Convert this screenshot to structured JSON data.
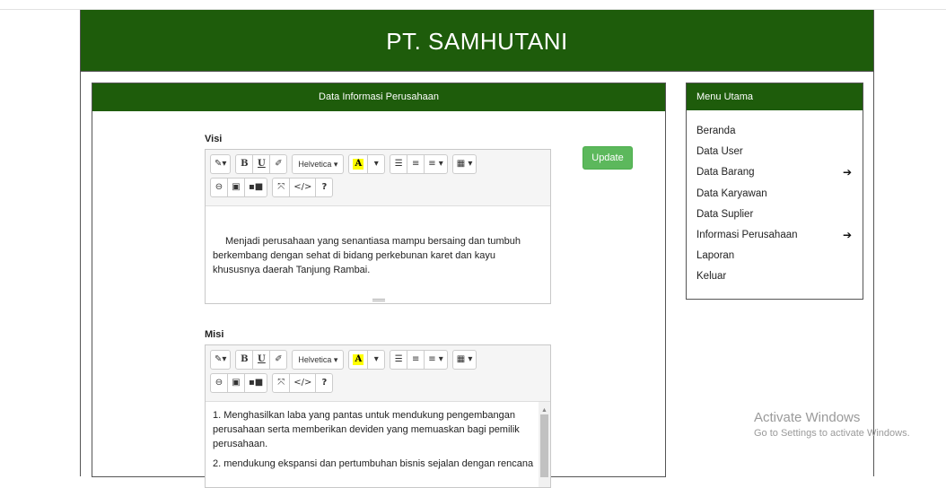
{
  "header": {
    "title": "PT. SAMHUTANI"
  },
  "panel": {
    "title": "Data Informasi Perusahaan"
  },
  "visi": {
    "label": "Visi",
    "text": "Menjadi perusahaan yang senantiasa mampu bersaing dan tumbuh berkembang dengan sehat di bidang perkebunan karet dan kayu khususnya daerah Tanjung Rambai."
  },
  "misi": {
    "label": "Misi",
    "items": [
      "1. Menghasilkan laba yang pantas untuk mendukung pengembangan perusahaan serta memberikan deviden yang memuaskan bagi pemilik perusahaan.",
      "2. mendukung ekspansi dan pertumbuhan bisnis sejalan dengan rencana"
    ]
  },
  "toolbar": {
    "style_glyph": "✎▾",
    "bold": "B",
    "underline": "U",
    "clear_glyph": "✐",
    "font": "Helvetica ▾",
    "color_a": "A",
    "color_caret": "▾",
    "ul_glyph": "☰",
    "ol_glyph": "≡",
    "align_glyph": "≡ ▾",
    "table_glyph": "▦ ▾",
    "link_glyph": "⊖",
    "picture_glyph": "▣",
    "hr_glyph": "▪■",
    "fullscreen_glyph": "⤧",
    "code": "</>",
    "help": "?"
  },
  "update_button": "Update",
  "menu": {
    "title": "Menu Utama",
    "items": [
      {
        "label": "Beranda",
        "arrow": ""
      },
      {
        "label": "Data User",
        "arrow": ""
      },
      {
        "label": "Data Barang",
        "arrow": "➔"
      },
      {
        "label": "Data Karyawan",
        "arrow": ""
      },
      {
        "label": "Data Suplier",
        "arrow": ""
      },
      {
        "label": "Informasi Perusahaan",
        "arrow": "➔"
      },
      {
        "label": "Laporan",
        "arrow": ""
      },
      {
        "label": "Keluar",
        "arrow": ""
      }
    ]
  },
  "watermark": {
    "line1": "Activate Windows",
    "line2": "Go to Settings to activate Windows."
  },
  "colors": {
    "brand_green": "#1e5c0b",
    "update_green": "#5cb85c"
  },
  "icons": [
    "magic-wand-icon",
    "bold-icon",
    "underline-icon",
    "eraser-icon",
    "text-color-icon",
    "unordered-list-icon",
    "ordered-list-icon",
    "align-icon",
    "table-icon",
    "link-icon",
    "picture-icon",
    "video-icon",
    "fullscreen-icon",
    "code-view-icon",
    "help-icon",
    "arrow-right-icon"
  ]
}
